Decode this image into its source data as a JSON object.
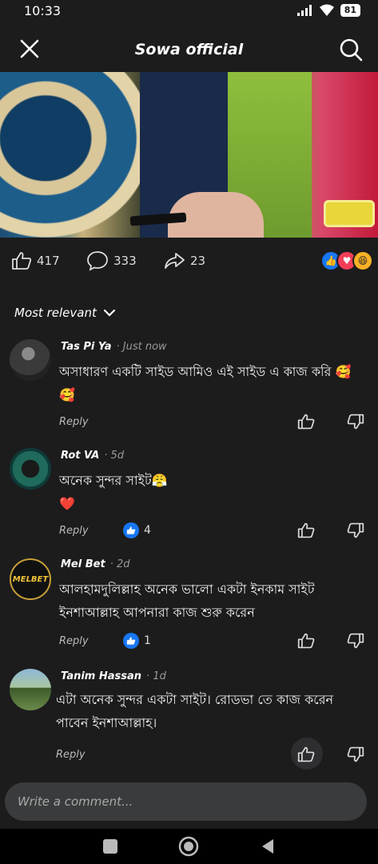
{
  "status": {
    "time": "10:33",
    "battery": "81"
  },
  "header": {
    "title": "Sowa official"
  },
  "post_stats": {
    "likes": "417",
    "comments": "333",
    "shares": "23"
  },
  "sort": {
    "label": "Most relevant"
  },
  "comments": [
    {
      "name": "Tas Pi Ya",
      "time": "Just now",
      "text": "অসাধারণ একটি সাইড আমিও এই সাইড এ কাজ করি 🥰🥰",
      "reply": "Reply",
      "likes": ""
    },
    {
      "name": "Rot VA",
      "time": "5d",
      "text": "অনেক সুন্দর সাইট😤\n❤️",
      "reply": "Reply",
      "likes": "4"
    },
    {
      "name": "Mel Bet",
      "time": "2d",
      "text": "আলহামদুলিল্লাহ অনেক ভালো একটা ইনকাম সাইট ইনশাআল্লাহ আপনারা কাজ শুরু করেন",
      "reply": "Reply",
      "likes": "1"
    },
    {
      "name": "Tanim Hassan",
      "time": "1d",
      "text": "এটা অনেক সুন্দর একটা সাইট। রোডভা তে কাজ করেন পাবেন ইনশাআল্লাহ।",
      "reply": "Reply",
      "likes": ""
    }
  ],
  "avatar_logo": {
    "melbet": "MELBET"
  },
  "composer": {
    "placeholder": "Write a comment..."
  },
  "colors": {
    "accent": "#1877f2",
    "background": "#1c1c1d",
    "composer": "#3a3b3c"
  }
}
